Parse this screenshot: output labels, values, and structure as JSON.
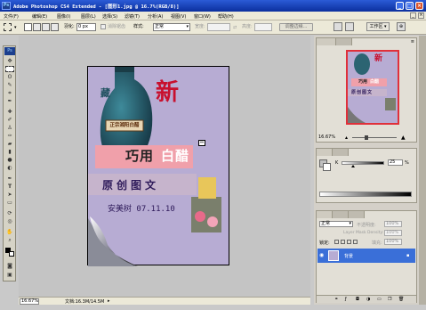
{
  "window": {
    "title": "Adobe Photoshop CS4 Extended - [图形1.jpg @ 16.7%(RGB/8)]",
    "ps_badge": "Ps",
    "controls": [
      "_",
      "□",
      "×"
    ]
  },
  "menubar": {
    "items": [
      "文件(F)",
      "编辑(E)",
      "图像(I)",
      "图层(L)",
      "选择(S)",
      "滤镜(T)",
      "分析(A)",
      "视图(V)",
      "窗口(W)",
      "帮助(H)"
    ]
  },
  "options": {
    "feather_label": "羽化:",
    "feather_value": "0 px",
    "antialias_label": "消除锯齿",
    "style_label": "样式:",
    "style_value": "正常",
    "width_label": "宽度:",
    "height_label": "高度:",
    "refine_button": "调整边缘...",
    "workspace_label": "工作区"
  },
  "toolbox": {
    "badge": "Ps"
  },
  "document": {
    "headline": "新",
    "seal": "正宗湘阳白醋",
    "badge_main": "巧用",
    "badge_accent": "白醋",
    "subtitle": "原创图文",
    "author_line": "安美树 07.11.10",
    "transform_label": "⇔"
  },
  "status": {
    "zoom": "16.67%",
    "doc_info": "文档:16.3M/14.5M"
  },
  "navigator": {
    "zoom": "16.67%",
    "thumb_headline": "新",
    "thumb_badge_main": "巧用",
    "thumb_badge_accent": "白醋",
    "thumb_subtitle": "原创图文"
  },
  "color": {
    "channel": "K",
    "value": "25",
    "unit": "%",
    "level": 0.25
  },
  "layers": {
    "blend_mode": "正常",
    "opacity_label": "不透明度:",
    "opacity_value": "100%",
    "lock_label": "锁定:",
    "fill_label": "填充:",
    "fill_value": "100%",
    "layer_name": "背景",
    "faint_label": "Layer Mask Density:",
    "faint_value": "100%"
  },
  "colors": {
    "title_bg": "#0b2f9e",
    "headline_red": "#c8102e",
    "badge_pink": "#f0a0aa",
    "canvas_bg": "#b7acd3",
    "layer_selected": "#3a6fd8"
  }
}
